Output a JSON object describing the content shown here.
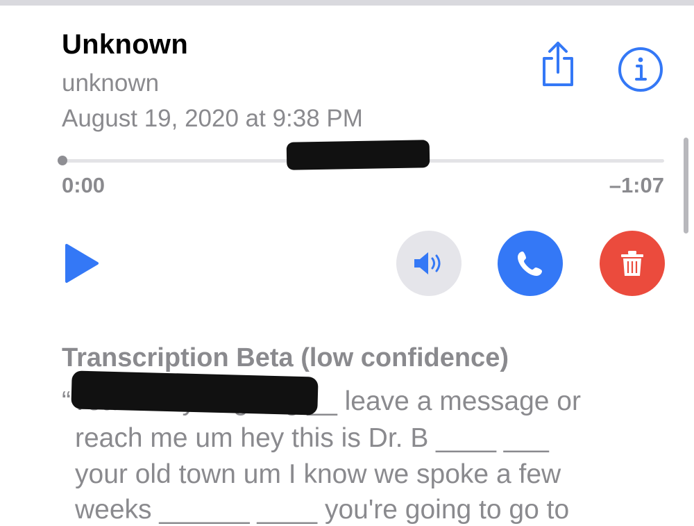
{
  "voicemail": {
    "caller_name": "Unknown",
    "caller_number": "unknown",
    "date": "August 19, 2020 at 9:38 PM"
  },
  "header_actions": {
    "share_icon": "share-icon",
    "info_icon": "info-icon"
  },
  "playback": {
    "elapsed": "0:00",
    "remaining": "–1:07",
    "progress_fraction": 0.0
  },
  "controls": {
    "play_icon": "play-icon",
    "speaker_icon": "speaker-icon",
    "callback_icon": "phone-icon",
    "delete_icon": "trash-icon",
    "colors": {
      "accent": "#3478f6",
      "speaker_bg": "#e5e5ea",
      "delete": "#eb4b3d"
    }
  },
  "transcription": {
    "title": "Transcription Beta (low confidence)",
    "lines": [
      "“Yeah hi Tyler going __ leave a message or",
      "reach me um hey this is Dr. B ____ ___",
      "your old town um I know we spoke a few",
      "weeks ______ ____ you're going to go to"
    ]
  }
}
